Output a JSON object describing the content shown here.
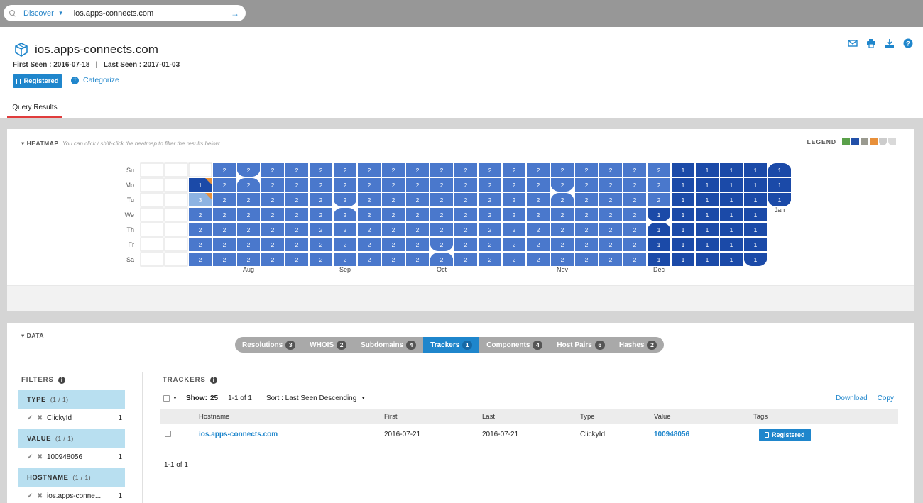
{
  "search": {
    "scope": "Discover",
    "query": "ios.apps-connects.com"
  },
  "header": {
    "title": "ios.apps-connects.com",
    "seen": "First Seen : 2016-07-18   |   Last Seen : 2017-01-03",
    "registered_label": "Registered",
    "categorize_label": "Categorize",
    "tab_label": "Query Results"
  },
  "heatmap": {
    "section_label": "HEATMAP",
    "hint": "You can click / shift-click the heatmap to filter the results below",
    "legend_label": "LEGEND",
    "legend_colors": [
      "#5aa04a",
      "#2250a8",
      "#9a9a90",
      "#e8903a",
      "#cccccc",
      "#d9d9d9"
    ],
    "days": [
      "Su",
      "Mo",
      "Tu",
      "We",
      "Th",
      "Fr",
      "Sa"
    ],
    "months": [
      {
        "label": "Aug",
        "week": 4
      },
      {
        "label": "Sep",
        "week": 8
      },
      {
        "label": "Oct",
        "week": 12
      },
      {
        "label": "Nov",
        "week": 17
      },
      {
        "label": "Dec",
        "week": 21
      },
      {
        "label": "Jan",
        "week": 26
      }
    ],
    "colors": {
      "empty": "#ffffff",
      "light": "#8db3e2",
      "mid": "#4a78cc",
      "dark": "#1b4aa8",
      "marker": "#e8903a"
    },
    "notches": [
      {
        "week": 4,
        "day": 0,
        "type": "bottom-right"
      },
      {
        "week": 4,
        "day": 1,
        "type": "top-right"
      },
      {
        "week": 8,
        "day": 2,
        "type": "bottom-right"
      },
      {
        "week": 8,
        "day": 3,
        "type": "top-right"
      },
      {
        "week": 12,
        "day": 5,
        "type": "bottom-right"
      },
      {
        "week": 12,
        "day": 6,
        "type": "top-right"
      },
      {
        "week": 17,
        "day": 1,
        "type": "bottom-right"
      },
      {
        "week": 17,
        "day": 2,
        "type": "top-right"
      },
      {
        "week": 21,
        "day": 3,
        "type": "bottom-right"
      },
      {
        "week": 21,
        "day": 4,
        "type": "top-right"
      },
      {
        "week": 26,
        "day": 0,
        "type": "top-right"
      },
      {
        "week": 26,
        "day": 2,
        "type": "bottom-right"
      },
      {
        "week": 25,
        "day": 6,
        "type": "bottom-right"
      }
    ],
    "grid": [
      [
        "",
        "",
        "",
        "",
        "",
        "",
        ""
      ],
      [
        "",
        "",
        "",
        "",
        "",
        "",
        ""
      ],
      [
        "",
        "1",
        "3",
        "2",
        "2",
        "2",
        "2"
      ],
      [
        "2",
        "2",
        "2",
        "2",
        "2",
        "2",
        "2"
      ],
      [
        "2",
        "2",
        "2",
        "2",
        "2",
        "2",
        "2"
      ],
      [
        "2",
        "2",
        "2",
        "2",
        "2",
        "2",
        "2"
      ],
      [
        "2",
        "2",
        "2",
        "2",
        "2",
        "2",
        "2"
      ],
      [
        "2",
        "2",
        "2",
        "2",
        "2",
        "2",
        "2"
      ],
      [
        "2",
        "2",
        "2",
        "2",
        "2",
        "2",
        "2"
      ],
      [
        "2",
        "2",
        "2",
        "2",
        "2",
        "2",
        "2"
      ],
      [
        "2",
        "2",
        "2",
        "2",
        "2",
        "2",
        "2"
      ],
      [
        "2",
        "2",
        "2",
        "2",
        "2",
        "2",
        "2"
      ],
      [
        "2",
        "2",
        "2",
        "2",
        "2",
        "2",
        "2"
      ],
      [
        "2",
        "2",
        "2",
        "2",
        "2",
        "2",
        "2"
      ],
      [
        "2",
        "2",
        "2",
        "2",
        "2",
        "2",
        "2"
      ],
      [
        "2",
        "2",
        "2",
        "2",
        "2",
        "2",
        "2"
      ],
      [
        "2",
        "2",
        "2",
        "2",
        "2",
        "2",
        "2"
      ],
      [
        "2",
        "2",
        "2",
        "2",
        "2",
        "2",
        "2"
      ],
      [
        "2",
        "2",
        "2",
        "2",
        "2",
        "2",
        "2"
      ],
      [
        "2",
        "2",
        "2",
        "2",
        "2",
        "2",
        "2"
      ],
      [
        "2",
        "2",
        "2",
        "2",
        "2",
        "2",
        "2"
      ],
      [
        "2",
        "2",
        "2",
        "1",
        "1",
        "1",
        "1"
      ],
      [
        "1",
        "1",
        "1",
        "1",
        "1",
        "1",
        "1"
      ],
      [
        "1",
        "1",
        "1",
        "1",
        "1",
        "1",
        "1"
      ],
      [
        "1",
        "1",
        "1",
        "1",
        "1",
        "1",
        "1"
      ],
      [
        "1",
        "1",
        "1",
        "1",
        "1",
        "1",
        "1"
      ],
      [
        "1",
        "1",
        "1",
        "",
        "",
        "",
        ""
      ]
    ]
  },
  "data_section": {
    "section_label": "DATA",
    "tabs": [
      {
        "label": "Resolutions",
        "count": "3",
        "active": false
      },
      {
        "label": "WHOIS",
        "count": "2",
        "active": false
      },
      {
        "label": "Subdomains",
        "count": "4",
        "active": false
      },
      {
        "label": "Trackers",
        "count": "1",
        "active": true
      },
      {
        "label": "Components",
        "count": "4",
        "active": false
      },
      {
        "label": "Host Pairs",
        "count": "6",
        "active": false
      },
      {
        "label": "Hashes",
        "count": "2",
        "active": false
      }
    ]
  },
  "filters": {
    "title": "FILTERS",
    "groups": [
      {
        "name": "TYPE",
        "count": "(1 / 1)",
        "value": "ClickyId",
        "n": "1"
      },
      {
        "name": "VALUE",
        "count": "(1 / 1)",
        "value": "100948056",
        "n": "1"
      },
      {
        "name": "HOSTNAME",
        "count": "(1 / 1)",
        "value": "ios.apps-conne...",
        "n": "1"
      }
    ]
  },
  "trackers": {
    "title": "TRACKERS",
    "show_label": "Show:",
    "show_value": "25",
    "range": "1-1 of 1",
    "sort": "Sort : Last Seen Descending",
    "download": "Download",
    "copy": "Copy",
    "columns": [
      "Hostname",
      "First",
      "Last",
      "Type",
      "Value",
      "Tags"
    ],
    "rows": [
      {
        "hostname": "ios.apps-connects.com",
        "first": "2016-07-21",
        "last": "2016-07-21",
        "type": "ClickyId",
        "value": "100948056",
        "tag": "Registered"
      }
    ],
    "footer": "1-1 of 1"
  }
}
